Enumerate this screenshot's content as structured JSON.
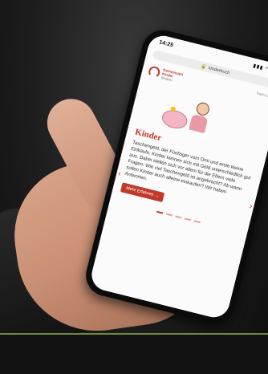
{
  "status": {
    "time": "14:25",
    "icons": "▮▮▮ ◠ ▭"
  },
  "browser": {
    "url": "kinderbuch"
  },
  "site": {
    "logo_line1": "Gemeinsam",
    "logo_line2": "Kinder",
    "logo_sub": "fördern",
    "nav_right": "Fach-Leiter"
  },
  "slide": {
    "title": "Kinder",
    "body": "Taschengeld, der Fünfziger vom Omi und erste kleine Einkäufe: Kinder kennen sich mit Geld unterschiedlich gut aus. Dabei stellen sich vor allem für die Eltern viele Fragen: Wie viel Taschengeld ist angebracht? Ab wann sollen Kinder auch alleine einkaufen? Wir haben Antworten.",
    "cta": "Mehr Erfahren →"
  },
  "colors": {
    "accent": "#c0392b",
    "divider": "#6d8a3f"
  }
}
